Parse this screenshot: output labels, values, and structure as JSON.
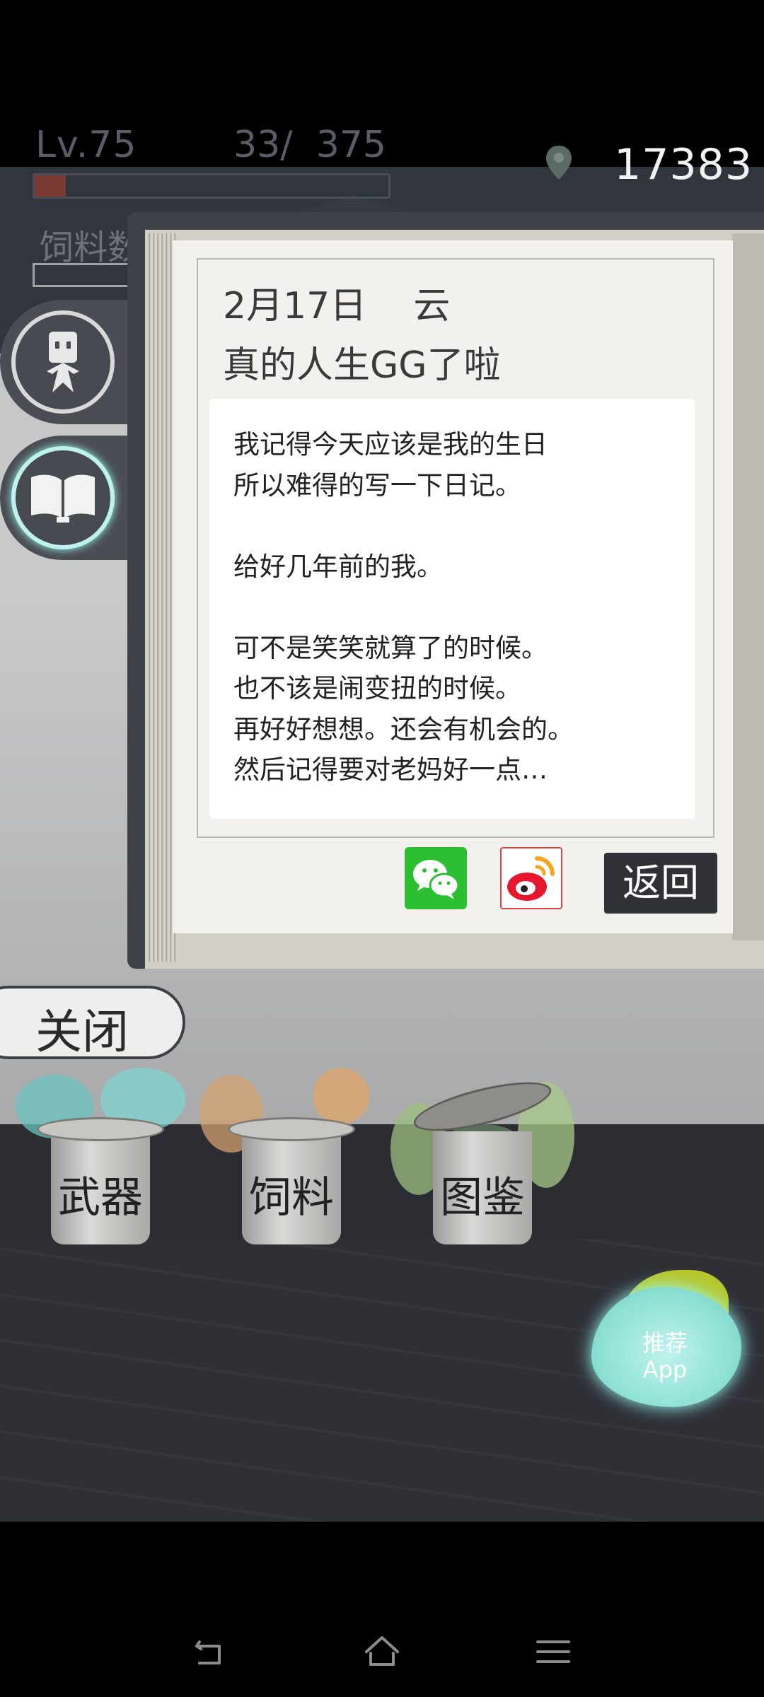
{
  "hud": {
    "level": "Lv.75",
    "exp": "33/  375",
    "exp_fraction": 0.088,
    "feed_label": "饲料数",
    "coins": "17383"
  },
  "diary": {
    "date": "2月17日    云",
    "title": "真的人生GG了啦",
    "body": "我记得今天应该是我的生日\n所以难得的写一下日记。\n\n给好几年前的我。\n\n可不是笑笑就算了的时候。\n也不该是闹变扭的时候。\n再好好想想。还会有机会的。\n然后记得要对老妈好一点…",
    "back_label": "返回"
  },
  "share": {
    "wechat_icon": "wechat-icon",
    "weibo_icon": "weibo-icon"
  },
  "close_label": "关闭",
  "cans": [
    {
      "label": "武器",
      "accent": "#7fd6d0"
    },
    {
      "label": "饲料",
      "accent": "#e0a56a"
    },
    {
      "label": "图鉴",
      "accent": "#a8c98a"
    }
  ],
  "recommend": {
    "line1": "推荐",
    "line2": "App"
  },
  "navbar": {
    "back_icon": "back-icon",
    "home_icon": "home-icon",
    "menu_icon": "menu-icon"
  }
}
